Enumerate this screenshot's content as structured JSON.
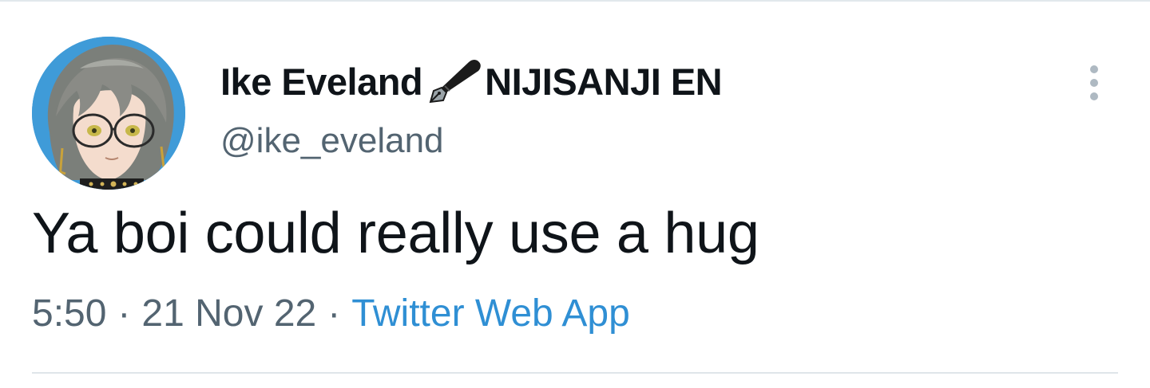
{
  "tweet": {
    "author": {
      "name_part1": "Ike Eveland",
      "name_part2": "NIJISANJI EN",
      "name_emoji_icon": "fountain-pen-icon",
      "handle": "@ike_eveland"
    },
    "text": "Ya boi could really use a hug",
    "time": "5:50",
    "date": "21 Nov 22",
    "separator": "·",
    "source": "Twitter Web App"
  },
  "icons": {
    "more": "vertical-ellipsis-icon"
  },
  "colors": {
    "text_primary": "#0f1419",
    "text_secondary": "#536471",
    "link": "#2f8fd4",
    "avatar_bg": "#3f9bd8",
    "divider": "#dfe5e9"
  }
}
